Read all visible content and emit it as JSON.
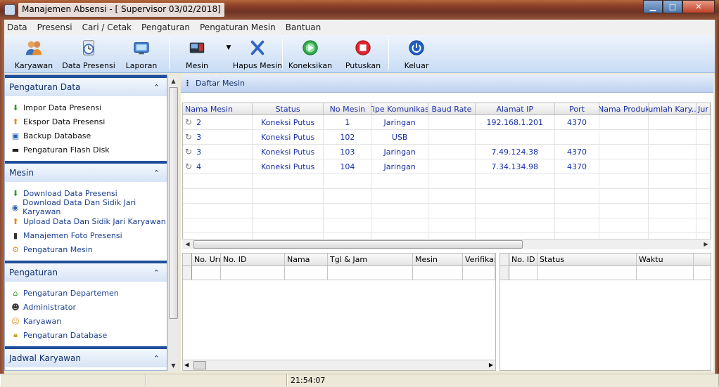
{
  "window": {
    "title": "Manajemen Absensi - [ Supervisor 03/02/2018]",
    "minimize": "▁",
    "maximize": "□",
    "close": "✕"
  },
  "menu": [
    "Data",
    "Presensi",
    "Cari / Cetak",
    "Pengaturan",
    "Pengaturan Mesin",
    "Bantuan"
  ],
  "toolbar": {
    "karyawan": "Karyawan",
    "data_presensi": "Data Presensi",
    "laporan": "Laporan",
    "mesin": "Mesin",
    "hapus_mesin": "Hapus Mesin",
    "koneksikan": "Koneksikan",
    "putuskan": "Putuskan",
    "keluar": "Keluar"
  },
  "sidebar": {
    "sections": [
      {
        "title": "Pengaturan Data",
        "items": [
          "Impor Data Presensi",
          "Ekspor Data Presensi",
          "Backup Database",
          "Pengaturan Flash Disk"
        ]
      },
      {
        "title": "Mesin",
        "items": [
          "Download Data Presensi",
          "Download Data Dan Sidik Jari Karyawan",
          "Upload Data Dan Sidik Jari Karyawan",
          "Manajemen Foto Presensi",
          "Pengaturan Mesin"
        ]
      },
      {
        "title": "Pengaturan",
        "items": [
          "Pengaturan Departemen",
          "Administrator",
          "Karyawan",
          "Pengaturan Database"
        ]
      },
      {
        "title": "Jadwal Karyawan",
        "items": []
      }
    ],
    "collapse_glyph": "⌃"
  },
  "main": {
    "header": "Daftar Mesin",
    "columns": [
      "Nama Mesin",
      "Status",
      "No Mesin",
      "Tipe Komunikasi",
      "Baud Rate",
      "Alamat IP",
      "Port",
      "Nama Produk",
      "Jumlah Kary...",
      "Jur"
    ],
    "rows": [
      [
        "2",
        "Koneksi Putus",
        "1",
        "Jaringan",
        "",
        "192.168.1.201",
        "4370",
        "",
        "",
        ""
      ],
      [
        "3",
        "Koneksi Putus",
        "102",
        "USB",
        "",
        "",
        "",
        "",
        "",
        ""
      ],
      [
        "3",
        "Koneksi Putus",
        "103",
        "Jaringan",
        "",
        "7.49.124.38",
        "4370",
        "",
        "",
        ""
      ],
      [
        "4",
        "Koneksi Putus",
        "104",
        "Jaringan",
        "",
        "7.34.134.98",
        "4370",
        "",
        "",
        ""
      ]
    ]
  },
  "lower_left": {
    "columns": [
      "No. Urut",
      "No. ID",
      "Nama",
      "Tgl & Jam",
      "Mesin",
      "Verifikasi"
    ]
  },
  "lower_right": {
    "columns": [
      "No. ID",
      "Status",
      "Waktu"
    ]
  },
  "status": {
    "time": "21:54:07"
  }
}
